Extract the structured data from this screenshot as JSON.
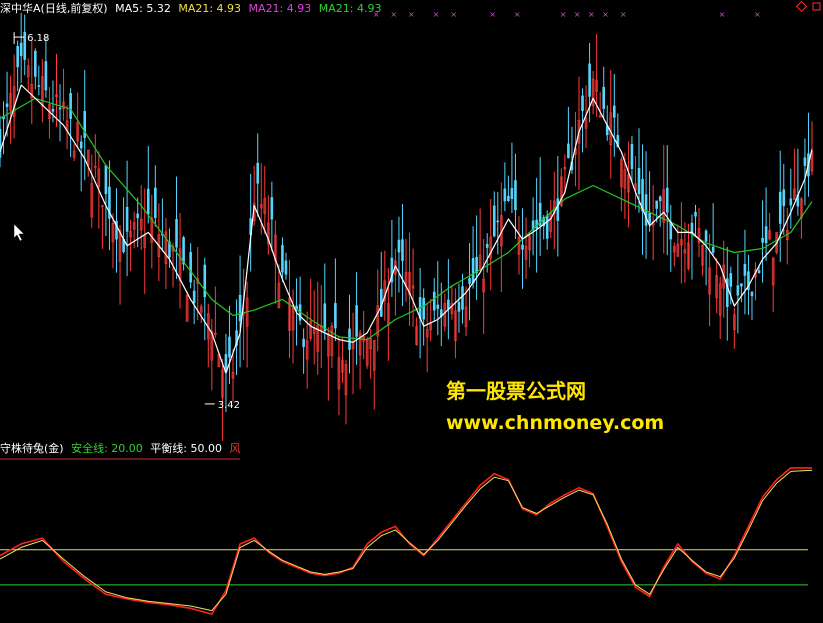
{
  "colors": {
    "bg": "#000000",
    "up": "#ff3b3b",
    "down": "#54d6ff",
    "ma5": "#ffffff",
    "ma21": "#22c622",
    "ind_red": "#ff2020",
    "ind_yellow": "#f0e060",
    "safe_line": "#e8e050",
    "balance_line": "#2fd02f",
    "marker": "#e040e0",
    "divider": "#d03030",
    "watermark": "#ffe600"
  },
  "header": {
    "title": "深中华A(日线,前复权)",
    "ma5_label": "MA5: 5.32",
    "ma21a_label": "MA21: 4.93",
    "ma21b_label": "MA21: 4.93",
    "ma21c_label": "MA21: 4.93"
  },
  "indicator_header": {
    "name": "守株待兔(金)",
    "safe_label": "安全线: 20.00",
    "balance_label": "平衡线: 50.00",
    "extra_label": "风"
  },
  "watermark": {
    "line1": "第一股票公式网",
    "line2": "www.chnmoney.com"
  },
  "chart_data": [
    {
      "type": "candlestick",
      "annotations": [
        "6.18",
        "3.42"
      ],
      "price_high": 6.18,
      "price_low": 3.42,
      "ma5_last": 5.32,
      "ma21_last": 4.93,
      "ylim": [
        3.3,
        6.3
      ],
      "close_path": [
        [
          0,
          5.4
        ],
        [
          6,
          5.9
        ],
        [
          12,
          5.75
        ],
        [
          18,
          5.55
        ],
        [
          24,
          5.3
        ],
        [
          30,
          4.95
        ],
        [
          36,
          4.6
        ],
        [
          42,
          4.8
        ],
        [
          48,
          4.6
        ],
        [
          54,
          4.3
        ],
        [
          60,
          4.05
        ],
        [
          64,
          3.58
        ],
        [
          66,
          3.7
        ],
        [
          70,
          4.25
        ],
        [
          72,
          5.0
        ],
        [
          76,
          4.8
        ],
        [
          80,
          4.35
        ],
        [
          84,
          4.0
        ],
        [
          88,
          3.95
        ],
        [
          92,
          3.9
        ],
        [
          96,
          3.85
        ],
        [
          100,
          3.83
        ],
        [
          104,
          3.9
        ],
        [
          108,
          4.1
        ],
        [
          112,
          4.5
        ],
        [
          116,
          4.3
        ],
        [
          120,
          3.95
        ],
        [
          124,
          4.1
        ],
        [
          128,
          4.2
        ],
        [
          132,
          4.25
        ],
        [
          136,
          4.4
        ],
        [
          140,
          4.65
        ],
        [
          144,
          4.9
        ],
        [
          148,
          4.7
        ],
        [
          152,
          4.75
        ],
        [
          156,
          4.8
        ],
        [
          160,
          5.05
        ],
        [
          164,
          5.5
        ],
        [
          168,
          5.8
        ],
        [
          172,
          5.55
        ],
        [
          176,
          5.35
        ],
        [
          180,
          5.05
        ],
        [
          184,
          4.75
        ],
        [
          188,
          4.9
        ],
        [
          192,
          4.65
        ],
        [
          196,
          4.75
        ],
        [
          200,
          4.6
        ],
        [
          204,
          4.4
        ],
        [
          208,
          4.1
        ],
        [
          212,
          4.3
        ],
        [
          216,
          4.55
        ],
        [
          220,
          4.65
        ],
        [
          224,
          4.9
        ],
        [
          228,
          5.15
        ],
        [
          230,
          5.35
        ]
      ],
      "ma5_path": [
        [
          0,
          5.3
        ],
        [
          6,
          5.8
        ],
        [
          12,
          5.65
        ],
        [
          18,
          5.5
        ],
        [
          24,
          5.25
        ],
        [
          30,
          4.9
        ],
        [
          36,
          4.6
        ],
        [
          42,
          4.7
        ],
        [
          48,
          4.5
        ],
        [
          54,
          4.2
        ],
        [
          60,
          3.95
        ],
        [
          64,
          3.65
        ],
        [
          68,
          3.95
        ],
        [
          72,
          4.9
        ],
        [
          76,
          4.65
        ],
        [
          80,
          4.35
        ],
        [
          84,
          4.1
        ],
        [
          88,
          4.0
        ],
        [
          92,
          3.95
        ],
        [
          96,
          3.9
        ],
        [
          100,
          3.88
        ],
        [
          104,
          3.95
        ],
        [
          108,
          4.15
        ],
        [
          112,
          4.45
        ],
        [
          116,
          4.25
        ],
        [
          120,
          4.0
        ],
        [
          124,
          4.05
        ],
        [
          128,
          4.15
        ],
        [
          132,
          4.25
        ],
        [
          136,
          4.4
        ],
        [
          140,
          4.6
        ],
        [
          144,
          4.8
        ],
        [
          148,
          4.65
        ],
        [
          152,
          4.72
        ],
        [
          156,
          4.8
        ],
        [
          160,
          5.0
        ],
        [
          164,
          5.45
        ],
        [
          168,
          5.7
        ],
        [
          172,
          5.5
        ],
        [
          176,
          5.3
        ],
        [
          180,
          5.0
        ],
        [
          184,
          4.75
        ],
        [
          188,
          4.85
        ],
        [
          192,
          4.7
        ],
        [
          196,
          4.7
        ],
        [
          200,
          4.6
        ],
        [
          204,
          4.45
        ],
        [
          208,
          4.15
        ],
        [
          212,
          4.3
        ],
        [
          216,
          4.5
        ],
        [
          220,
          4.62
        ],
        [
          224,
          4.85
        ],
        [
          228,
          5.1
        ],
        [
          230,
          5.32
        ]
      ],
      "ma21_path": [
        [
          0,
          5.55
        ],
        [
          10,
          5.7
        ],
        [
          20,
          5.62
        ],
        [
          30,
          5.2
        ],
        [
          40,
          4.9
        ],
        [
          50,
          4.55
        ],
        [
          60,
          4.2
        ],
        [
          66,
          4.08
        ],
        [
          72,
          4.12
        ],
        [
          80,
          4.2
        ],
        [
          88,
          4.05
        ],
        [
          96,
          3.92
        ],
        [
          104,
          3.9
        ],
        [
          112,
          4.05
        ],
        [
          120,
          4.15
        ],
        [
          128,
          4.3
        ],
        [
          136,
          4.42
        ],
        [
          144,
          4.55
        ],
        [
          152,
          4.75
        ],
        [
          160,
          4.95
        ],
        [
          168,
          5.05
        ],
        [
          176,
          4.95
        ],
        [
          184,
          4.85
        ],
        [
          192,
          4.75
        ],
        [
          200,
          4.62
        ],
        [
          208,
          4.55
        ],
        [
          216,
          4.58
        ],
        [
          224,
          4.7
        ],
        [
          230,
          4.93
        ]
      ]
    },
    {
      "type": "line",
      "safe_line": 20,
      "balance_line": 50,
      "ylim": [
        -10,
        125
      ],
      "red_path": [
        [
          0,
          45
        ],
        [
          6,
          55
        ],
        [
          12,
          60
        ],
        [
          18,
          40
        ],
        [
          24,
          25
        ],
        [
          30,
          12
        ],
        [
          36,
          8
        ],
        [
          42,
          5
        ],
        [
          48,
          3
        ],
        [
          54,
          0
        ],
        [
          60,
          -5
        ],
        [
          64,
          15
        ],
        [
          68,
          55
        ],
        [
          72,
          60
        ],
        [
          76,
          48
        ],
        [
          80,
          40
        ],
        [
          84,
          35
        ],
        [
          88,
          30
        ],
        [
          92,
          28
        ],
        [
          96,
          30
        ],
        [
          100,
          35
        ],
        [
          104,
          55
        ],
        [
          108,
          65
        ],
        [
          112,
          70
        ],
        [
          116,
          55
        ],
        [
          120,
          45
        ],
        [
          124,
          60
        ],
        [
          128,
          75
        ],
        [
          132,
          90
        ],
        [
          136,
          105
        ],
        [
          140,
          115
        ],
        [
          144,
          110
        ],
        [
          148,
          85
        ],
        [
          152,
          80
        ],
        [
          156,
          90
        ],
        [
          160,
          97
        ],
        [
          164,
          103
        ],
        [
          168,
          98
        ],
        [
          172,
          70
        ],
        [
          176,
          40
        ],
        [
          180,
          18
        ],
        [
          184,
          10
        ],
        [
          188,
          35
        ],
        [
          192,
          55
        ],
        [
          196,
          40
        ],
        [
          200,
          30
        ],
        [
          204,
          25
        ],
        [
          208,
          45
        ],
        [
          212,
          70
        ],
        [
          216,
          95
        ],
        [
          220,
          110
        ],
        [
          224,
          120
        ],
        [
          230,
          120
        ]
      ],
      "yellow_path": [
        [
          0,
          42
        ],
        [
          6,
          52
        ],
        [
          12,
          58
        ],
        [
          18,
          42
        ],
        [
          24,
          27
        ],
        [
          30,
          14
        ],
        [
          36,
          9
        ],
        [
          42,
          6
        ],
        [
          48,
          4
        ],
        [
          54,
          2
        ],
        [
          60,
          -2
        ],
        [
          64,
          12
        ],
        [
          68,
          52
        ],
        [
          72,
          58
        ],
        [
          76,
          49
        ],
        [
          80,
          41
        ],
        [
          84,
          36
        ],
        [
          88,
          31
        ],
        [
          92,
          29
        ],
        [
          96,
          31
        ],
        [
          100,
          34
        ],
        [
          104,
          52
        ],
        [
          108,
          62
        ],
        [
          112,
          67
        ],
        [
          116,
          56
        ],
        [
          120,
          46
        ],
        [
          124,
          58
        ],
        [
          128,
          73
        ],
        [
          132,
          88
        ],
        [
          136,
          102
        ],
        [
          140,
          112
        ],
        [
          144,
          109
        ],
        [
          148,
          86
        ],
        [
          152,
          81
        ],
        [
          156,
          88
        ],
        [
          160,
          95
        ],
        [
          164,
          101
        ],
        [
          168,
          97
        ],
        [
          172,
          72
        ],
        [
          176,
          42
        ],
        [
          180,
          20
        ],
        [
          184,
          12
        ],
        [
          188,
          33
        ],
        [
          192,
          52
        ],
        [
          196,
          41
        ],
        [
          200,
          31
        ],
        [
          204,
          27
        ],
        [
          208,
          43
        ],
        [
          212,
          67
        ],
        [
          216,
          92
        ],
        [
          220,
          107
        ],
        [
          224,
          117
        ],
        [
          230,
          118
        ]
      ]
    }
  ]
}
